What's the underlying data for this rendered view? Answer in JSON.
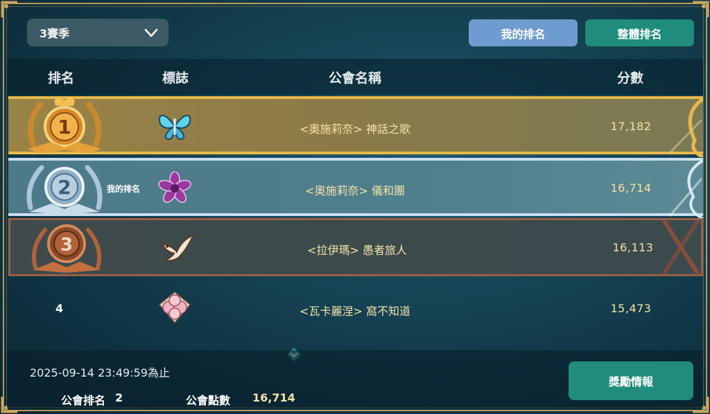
{
  "season_select": {
    "label": "3賽季",
    "icon": "chevron-down-icon"
  },
  "tabs": {
    "my_rank": "我的排名",
    "overall_rank": "整體排名"
  },
  "header": {
    "rank": "排名",
    "logo": "標誌",
    "guild_name": "公會名稱",
    "score": "分數"
  },
  "rows": [
    {
      "rank": "1",
      "medal": "gold-medal-icon",
      "emblem": "butterfly-emblem-icon",
      "guild": "<奧施莉奈> 神話之歌",
      "score": "17,182",
      "tag": ""
    },
    {
      "rank": "2",
      "medal": "silver-medal-icon",
      "emblem": "purple-flower-emblem-icon",
      "guild": "<奧施莉奈> 儀和團",
      "score": "16,714",
      "tag": "我的排名"
    },
    {
      "rank": "3",
      "medal": "bronze-medal-icon",
      "emblem": "dove-emblem-icon",
      "guild": "<拉伊瑪> 愚者旅人",
      "score": "16,113",
      "tag": ""
    },
    {
      "rank": "4",
      "medal": "",
      "emblem": "rose-emblem-icon",
      "guild": "<瓦卡麗涅> 窩不知道",
      "score": "15,473",
      "tag": ""
    }
  ],
  "footer": {
    "deadline": "2025-09-14 23:49:59為止",
    "guild_rank_label": "公會排名",
    "guild_rank_value": "2",
    "guild_points_label": "公會點數",
    "guild_points_value": "16,714",
    "reward_button": "獎勵情報"
  },
  "colors": {
    "gold": "#e9b84a",
    "silver": "#c9dff0",
    "bronze": "#9a5e4a",
    "accent_teal": "#1f8c7c",
    "accent_blue": "#6e9bd0",
    "score_text": "#f4e2a8"
  }
}
